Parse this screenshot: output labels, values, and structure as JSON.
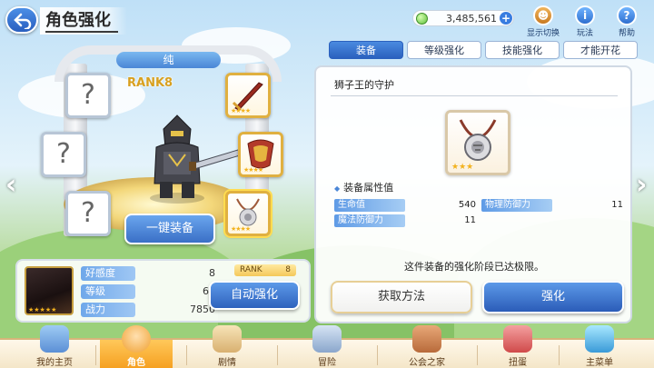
{
  "header": {
    "title": "角色强化",
    "currency_amount": "3,485,561",
    "currency_plus": "+",
    "icons": [
      {
        "label": "显示切换",
        "icon": "display-toggle-icon"
      },
      {
        "label": "玩法",
        "icon": "info-icon"
      },
      {
        "label": "帮助",
        "icon": "help-icon"
      }
    ]
  },
  "character": {
    "name": "纯",
    "rank_label": "RANK8",
    "one_click_equip": "一键装备",
    "equipment_slots": [
      {
        "state": "empty",
        "glyph": "?"
      },
      {
        "state": "empty",
        "glyph": "?"
      },
      {
        "state": "empty",
        "glyph": "?"
      },
      {
        "state": "equipped",
        "item": "sword",
        "stars": "★★★★"
      },
      {
        "state": "equipped",
        "item": "armor",
        "stars": "★★★★"
      },
      {
        "state": "equipped",
        "item": "lion-necklace",
        "stars": "★★★★"
      }
    ]
  },
  "stats": {
    "portrait_stars": "★★★★★",
    "rows": [
      {
        "name": "好感度",
        "value": "8"
      },
      {
        "name": "等级",
        "value": "67"
      },
      {
        "name": "战力",
        "value": "7850"
      }
    ],
    "rank_tag": "RANK",
    "rank_value": "8",
    "auto_enhance": "自动强化"
  },
  "tabs": [
    {
      "label": "装备",
      "active": true
    },
    {
      "label": "等级强化",
      "active": false
    },
    {
      "label": "技能强化",
      "active": false
    },
    {
      "label": "才能开花",
      "active": false
    }
  ],
  "equipment_detail": {
    "name": "狮子王的守护",
    "stars": "★★★",
    "attributes_header": "装备属性值",
    "attributes": [
      {
        "name": "生命值",
        "value": "540"
      },
      {
        "name": "物理防御力",
        "value": "11"
      },
      {
        "name": "魔法防御力",
        "value": "11"
      }
    ],
    "limit_message": "这件装备的强化阶段已达极限。",
    "acquire_button": "获取方法",
    "enhance_button": "强化"
  },
  "nav": {
    "left_arrow": "‹",
    "right_arrow": "›"
  },
  "bottom_nav": [
    {
      "label": "我的主页",
      "active": false
    },
    {
      "label": "角色",
      "active": true
    },
    {
      "label": "剧情",
      "active": false
    },
    {
      "label": "冒险",
      "active": false
    },
    {
      "label": "公会之家",
      "active": false
    },
    {
      "label": "扭蛋",
      "active": false
    },
    {
      "label": "主菜单",
      "active": false
    }
  ],
  "colors": {
    "accent_blue": "#3a6fc6",
    "gold": "#d8a020",
    "active_nav": "#f59e1e"
  }
}
